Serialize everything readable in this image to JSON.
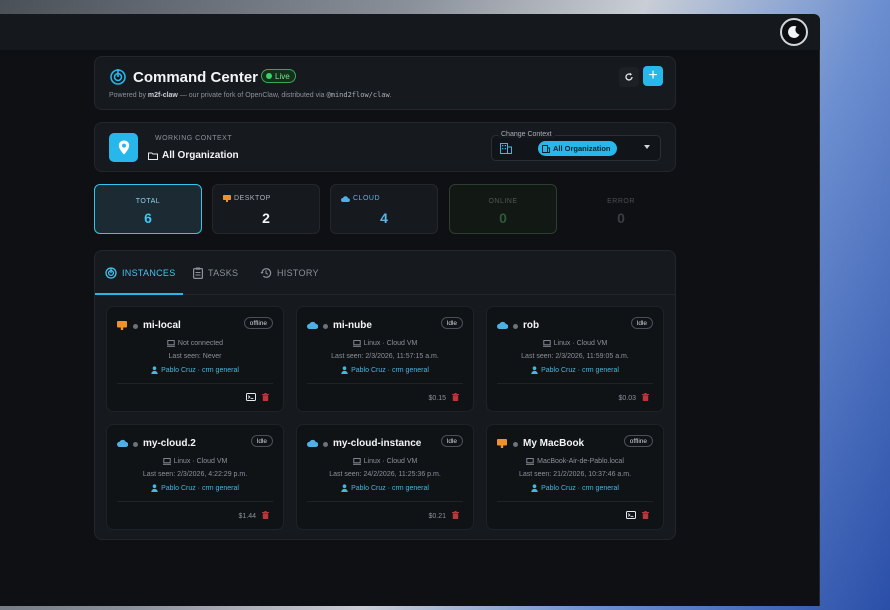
{
  "header": {
    "title": "Command Center",
    "live_label": "Live",
    "subtitle_prefix": "Powered by ",
    "subtitle_brand": "m2f-claw",
    "subtitle_middle": " — our private fork of OpenClaw, distributed via ",
    "subtitle_repo": "@mind2flow/claw",
    "subtitle_suffix": "."
  },
  "context": {
    "label": "WORKING CONTEXT",
    "value": "All Organization",
    "change_label": "Change Context",
    "selected": "All Organization"
  },
  "stats": {
    "total": {
      "label": "TOTAL",
      "value": "6"
    },
    "desktop": {
      "label": "DESKTOP",
      "value": "2"
    },
    "cloud": {
      "label": "CLOUD",
      "value": "4"
    },
    "online": {
      "label": "ONLINE",
      "value": "0"
    },
    "error": {
      "label": "ERROR",
      "value": "0"
    }
  },
  "tabs": [
    {
      "label": "INSTANCES",
      "active": true
    },
    {
      "label": "TASKS",
      "active": false
    },
    {
      "label": "HISTORY",
      "active": false
    }
  ],
  "instances": [
    {
      "name": "mi-local",
      "type": "desktop",
      "status": "offline",
      "os": "Not connected",
      "last_seen": "Last seen: Never",
      "owner": "Pablo Cruz · crm general",
      "cost": "",
      "terminal": true
    },
    {
      "name": "mi-nube",
      "type": "cloud",
      "status": "Idle",
      "os": "Linux · Cloud VM",
      "last_seen": "Last seen: 2/3/2026, 11:57:15 a.m.",
      "owner": "Pablo Cruz · crm general",
      "cost": "$0.15",
      "terminal": false
    },
    {
      "name": "rob",
      "type": "cloud",
      "status": "Idle",
      "os": "Linux · Cloud VM",
      "last_seen": "Last seen: 2/3/2026, 11:59:05 a.m.",
      "owner": "Pablo Cruz · crm general",
      "cost": "$0.03",
      "terminal": false
    },
    {
      "name": "my-cloud.2",
      "type": "cloud",
      "status": "Idle",
      "os": "Linux · Cloud VM",
      "last_seen": "Last seen: 2/3/2026, 4:22:29 p.m.",
      "owner": "Pablo Cruz · crm general",
      "cost": "$1.44",
      "terminal": false
    },
    {
      "name": "my-cloud-instance",
      "type": "cloud",
      "status": "Idle",
      "os": "Linux · Cloud VM",
      "last_seen": "Last seen: 24/2/2026, 11:25:36 p.m.",
      "owner": "Pablo Cruz · crm general",
      "cost": "$0.21",
      "terminal": false
    },
    {
      "name": "My MacBook",
      "type": "desktop",
      "status": "offline",
      "os": "MacBook-Air-de-Pablo.local",
      "last_seen": "Last seen: 21/2/2026, 10:37:46 a.m.",
      "owner": "Pablo Cruz · crm general",
      "cost": "",
      "terminal": true
    }
  ],
  "colors": {
    "accent": "#27b7ea",
    "desktop": "#f0922b",
    "cloud": "#4fb0e6",
    "danger": "#b8373b",
    "live": "#3bd16a"
  }
}
